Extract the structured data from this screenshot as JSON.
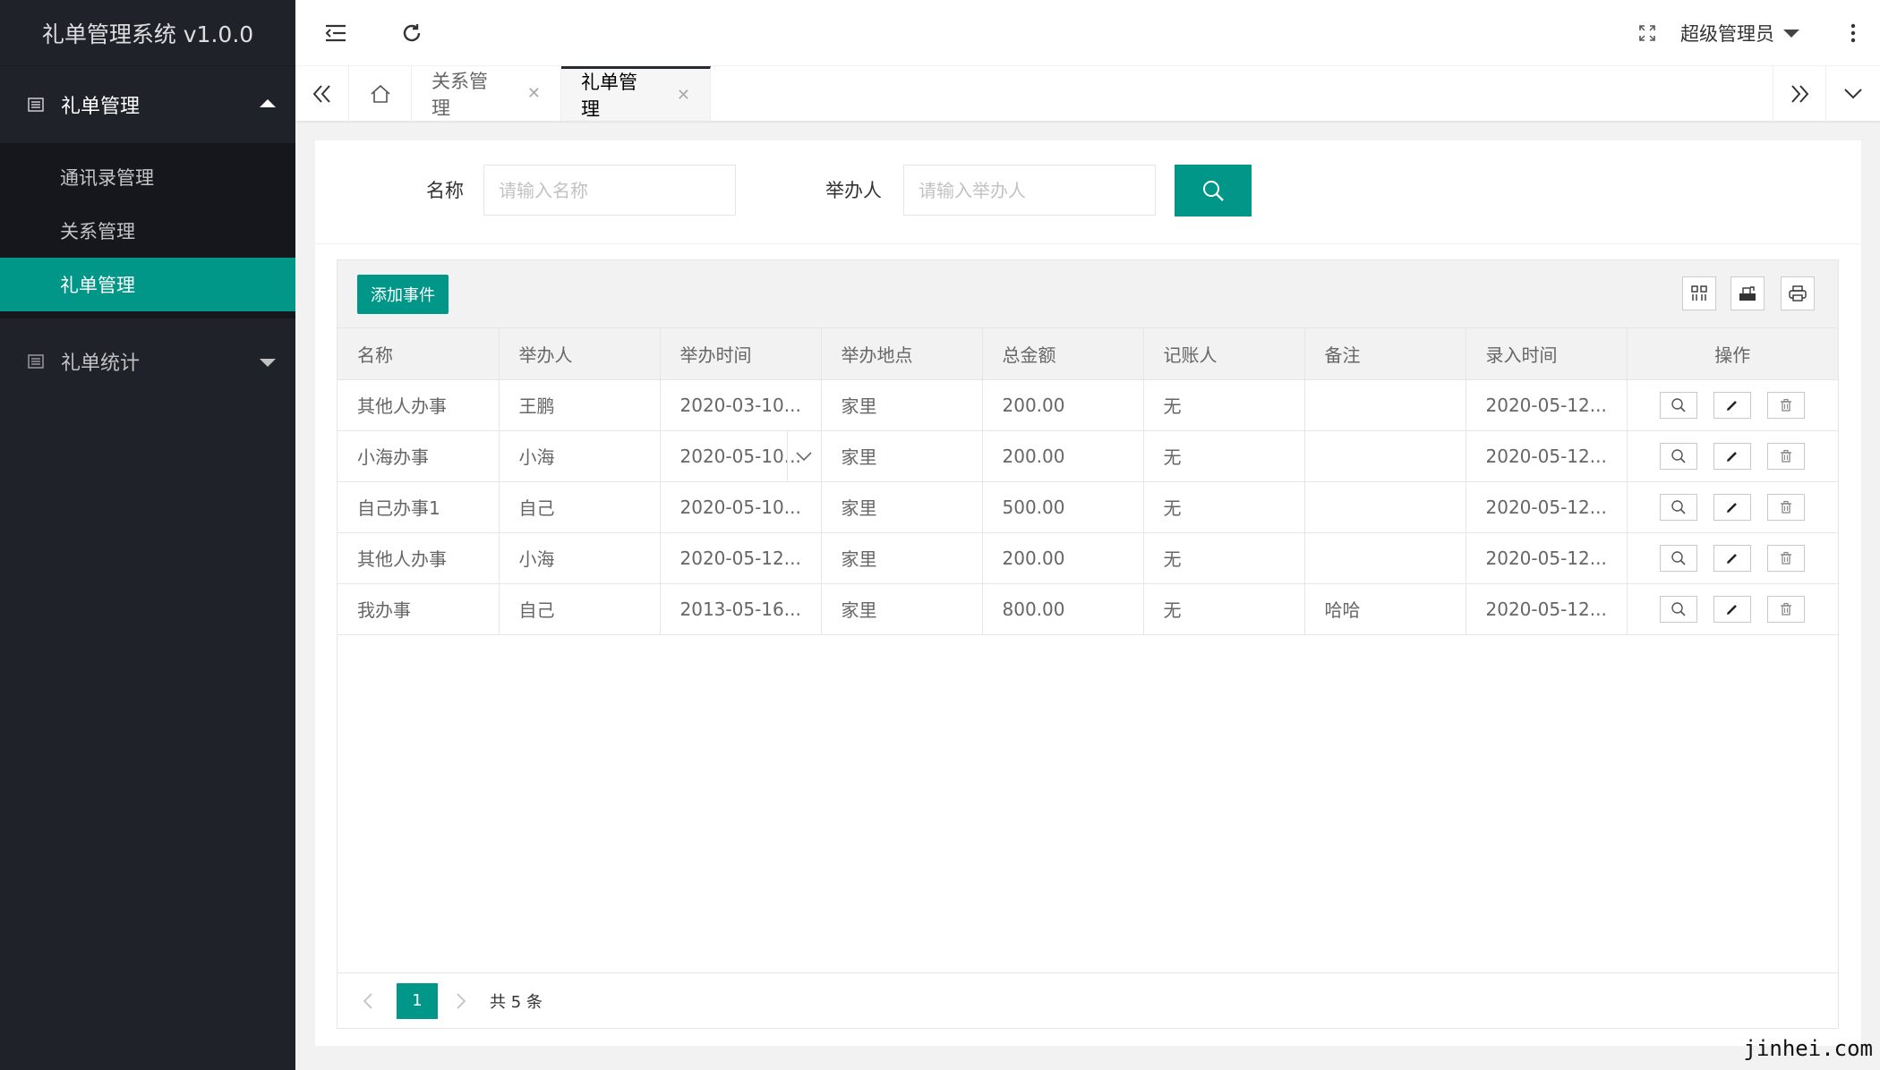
{
  "app": {
    "title": "礼单管理系统 v1.0.0"
  },
  "sidebar": {
    "groups": [
      {
        "label": "礼单管理",
        "expanded": true,
        "items": [
          {
            "label": "通讯录管理"
          },
          {
            "label": "关系管理"
          },
          {
            "label": "礼单管理",
            "active": true
          }
        ]
      },
      {
        "label": "礼单统计",
        "expanded": false
      }
    ]
  },
  "header": {
    "user": "超级管理员"
  },
  "tabs": [
    {
      "label": "关系管理"
    },
    {
      "label": "礼单管理",
      "active": true
    }
  ],
  "search": {
    "name_label": "名称",
    "name_placeholder": "请输入名称",
    "host_label": "举办人",
    "host_placeholder": "请输入举办人"
  },
  "toolbar": {
    "add_label": "添加事件"
  },
  "table": {
    "columns": [
      "名称",
      "举办人",
      "举办时间",
      "举办地点",
      "总金额",
      "记账人",
      "备注",
      "录入时间",
      "操作"
    ],
    "rows": [
      [
        "其他人办事",
        "王鹏",
        "2020-03-10...",
        "家里",
        "200.00",
        "无",
        "",
        "2020-05-12..."
      ],
      [
        "小海办事",
        "小海",
        "2020-05-10...",
        "家里",
        "200.00",
        "无",
        "",
        "2020-05-12..."
      ],
      [
        "自己办事1",
        "自己",
        "2020-05-10...",
        "家里",
        "500.00",
        "无",
        "",
        "2020-05-12..."
      ],
      [
        "其他人办事",
        "小海",
        "2020-05-12...",
        "家里",
        "200.00",
        "无",
        "",
        "2020-05-12..."
      ],
      [
        "我办事",
        "自己",
        "2013-05-16...",
        "家里",
        "800.00",
        "无",
        "哈哈",
        "2020-05-12..."
      ]
    ]
  },
  "pager": {
    "current": "1",
    "total_text": "共 5 条"
  },
  "watermark": "jinhei.com",
  "colors": {
    "accent": "#009688",
    "sidebar_bg": "#20222a",
    "submenu_bg": "#16171c"
  }
}
